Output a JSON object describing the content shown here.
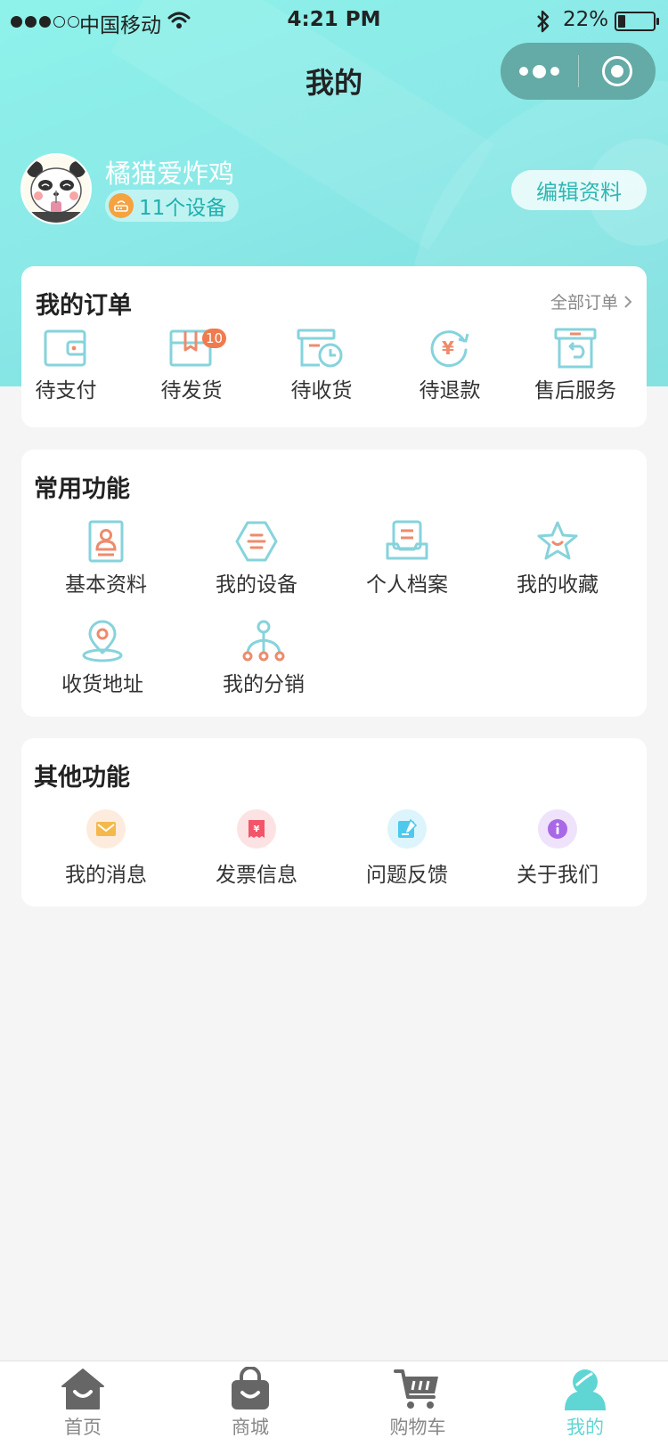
{
  "status_bar": {
    "carrier": "中国移动",
    "time": "4:21 PM",
    "battery_percent": "22%",
    "battery_level": 0.22,
    "signal_bars_filled": 3,
    "signal_bars_total": 5
  },
  "nav": {
    "title": "我的"
  },
  "profile": {
    "username": "橘猫爱炸鸡",
    "device_count_label": "11个设备",
    "edit_button": "编辑资料"
  },
  "orders": {
    "title": "我的订单",
    "all_link": "全部订单",
    "items": [
      {
        "label": "待支付",
        "icon": "wallet-icon"
      },
      {
        "label": "待发货",
        "icon": "box-icon",
        "badge": "10"
      },
      {
        "label": "待收货",
        "icon": "delivery-clock-icon"
      },
      {
        "label": "待退款",
        "icon": "refund-icon"
      },
      {
        "label": "售后服务",
        "icon": "after-sales-icon"
      }
    ]
  },
  "common_features": {
    "title": "常用功能",
    "items": [
      {
        "label": "基本资料",
        "icon": "profile-card-icon"
      },
      {
        "label": "我的设备",
        "icon": "device-icon"
      },
      {
        "label": "个人档案",
        "icon": "archive-icon"
      },
      {
        "label": "我的收藏",
        "icon": "star-icon"
      },
      {
        "label": "收货地址",
        "icon": "location-icon"
      },
      {
        "label": "我的分销",
        "icon": "distribution-icon"
      }
    ]
  },
  "other_features": {
    "title": "其他功能",
    "items": [
      {
        "label": "我的消息",
        "icon": "mail-icon",
        "color": "#f5b84a"
      },
      {
        "label": "发票信息",
        "icon": "invoice-icon",
        "color": "#f2556a"
      },
      {
        "label": "问题反馈",
        "icon": "feedback-icon",
        "color": "#4cc9ec"
      },
      {
        "label": "关于我们",
        "icon": "info-icon",
        "color": "#a968e6"
      }
    ]
  },
  "tabbar": {
    "items": [
      {
        "label": "首页",
        "icon": "home-icon",
        "active": false
      },
      {
        "label": "商城",
        "icon": "shopping-bag-icon",
        "active": false
      },
      {
        "label": "购物车",
        "icon": "cart-icon",
        "active": false
      },
      {
        "label": "我的",
        "icon": "user-icon",
        "active": true
      }
    ]
  },
  "colors": {
    "accent": "#5fd6d4",
    "header_bg": "#8be9e7",
    "icon_teal": "#86d3dc",
    "icon_orange": "#ee8b6c",
    "badge": "#f07b4f"
  }
}
